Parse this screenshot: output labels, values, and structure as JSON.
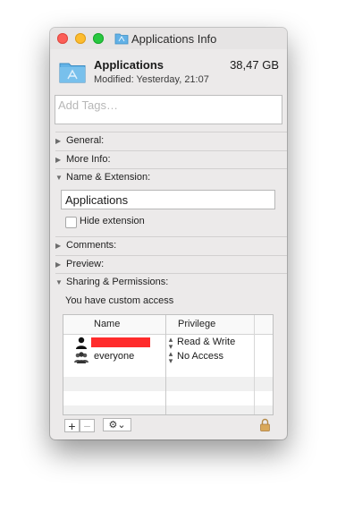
{
  "window": {
    "title": "Applications Info",
    "accent_folder_color": "#5fb0e4"
  },
  "header": {
    "name": "Applications",
    "size": "38,47 GB",
    "modified_label": "Modified:",
    "modified_value": "Yesterday, 21:07"
  },
  "tags": {
    "placeholder": "Add Tags…"
  },
  "sections": {
    "general": "General:",
    "more_info": "More Info:",
    "name_extension": "Name & Extension:",
    "comments": "Comments:",
    "preview": "Preview:",
    "sharing": "Sharing & Permissions:"
  },
  "name_extension": {
    "name_value": "Applications",
    "hide_extension_label": "Hide extension"
  },
  "sharing": {
    "access_text": "You have custom access",
    "columns": {
      "name": "Name",
      "privilege": "Privilege"
    },
    "rows": [
      {
        "name": "",
        "privilege": "Read & Write",
        "icon": "user-icon",
        "redacted": true
      },
      {
        "name": "everyone",
        "privilege": "No Access",
        "icon": "group-icon",
        "redacted": false
      }
    ]
  },
  "footer": {
    "add_label": "+",
    "remove_label": "−",
    "gear_label": "⚙︎⌄"
  }
}
